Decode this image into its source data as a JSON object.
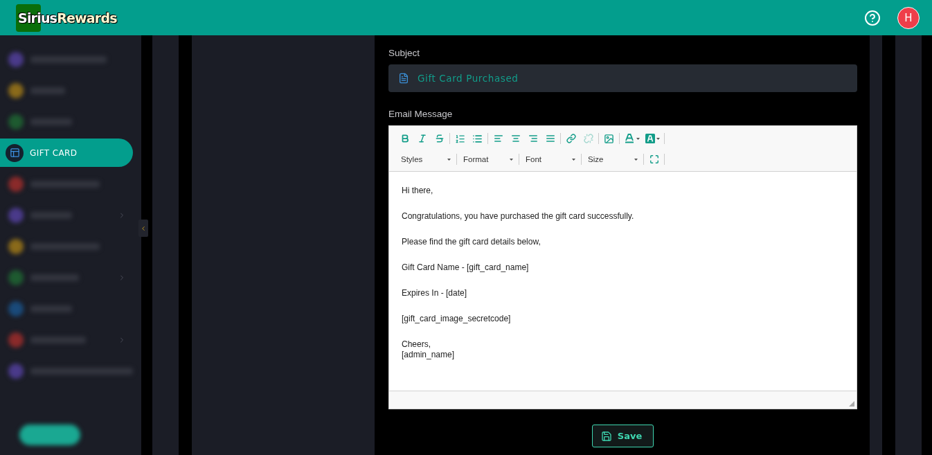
{
  "header": {
    "logo": {
      "first": "Sirius",
      "second": "Rewards"
    },
    "avatar": "H"
  },
  "sidebar": {
    "items": [
      {
        "kind": "blurred",
        "color": "#4a3a8a",
        "selected": false
      },
      {
        "kind": "blurred",
        "color": "#8a6a1a",
        "selected": false
      },
      {
        "kind": "blurred",
        "color": "#1e5a30",
        "selected": false
      },
      {
        "kind": "label",
        "label": "GIFT CARD",
        "selected": true
      },
      {
        "kind": "blurred",
        "color": "#8a2a2a",
        "selected": false
      },
      {
        "kind": "blurred",
        "color": "#4a3a8a",
        "selected": false,
        "expandable": true
      },
      {
        "kind": "blurred",
        "color": "#8a6a1a",
        "selected": false
      },
      {
        "kind": "blurred",
        "color": "#1e5a30",
        "selected": false,
        "expandable": true
      },
      {
        "kind": "blurred",
        "color": "#1a4a7a",
        "selected": false
      },
      {
        "kind": "blurred",
        "color": "#8a2a2a",
        "selected": false,
        "expandable": true
      },
      {
        "kind": "blurred",
        "color": "#4a3a8a",
        "selected": false
      }
    ],
    "collapsed": false
  },
  "form": {
    "subject_label": "Subject",
    "subject_value": "Gift Card Purchased",
    "message_label": "Email Message",
    "toolbar_row1": [
      {
        "kind": "bold"
      },
      {
        "kind": "italic"
      },
      {
        "kind": "strike"
      },
      {
        "kind": "sep"
      },
      {
        "kind": "ol"
      },
      {
        "kind": "ul"
      },
      {
        "kind": "sep"
      },
      {
        "kind": "left"
      },
      {
        "kind": "center"
      },
      {
        "kind": "right"
      },
      {
        "kind": "justify"
      },
      {
        "kind": "sep"
      },
      {
        "kind": "link"
      },
      {
        "kind": "unlink",
        "disabled": true
      },
      {
        "kind": "sep"
      },
      {
        "kind": "image"
      },
      {
        "kind": "sep"
      },
      {
        "kind": "textcolor"
      },
      {
        "kind": "bgcolor"
      },
      {
        "kind": "sep"
      }
    ],
    "dropdowns": [
      "Styles",
      "Format",
      "Font",
      "Size"
    ],
    "message": [
      {
        "lines": [
          "Hi there,"
        ]
      },
      {
        "lines": [
          "Congratulations, you have purchased the gift card successfully."
        ]
      },
      {
        "lines": [
          "Please find the gift card details below,"
        ]
      },
      {
        "lines": [
          "Gift Card Name - [gift_card_name]"
        ]
      },
      {
        "lines": [
          "Expires In - [date]"
        ]
      },
      {
        "lines": [
          "[gift_card_image_secretcode]"
        ]
      },
      {
        "lines": [
          "Cheers,",
          "[admin_name]"
        ]
      }
    ],
    "save": "Save"
  }
}
